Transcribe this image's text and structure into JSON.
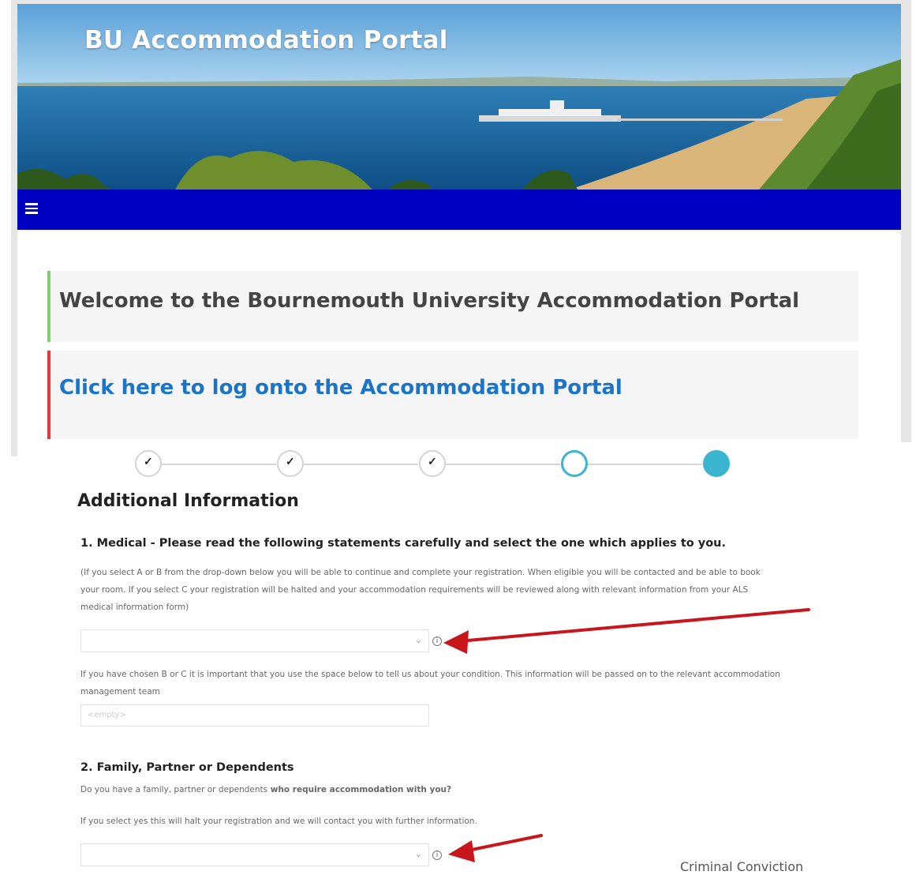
{
  "portal": {
    "site_title": "BU Accommodation Portal",
    "menu_icon": "hamburger-menu-icon",
    "welcome_heading": "Welcome to the Bournemouth University Accommodation Portal",
    "login_link": "Click here to log onto the Accommodation Portal",
    "colors": {
      "navbar": "#0000c2",
      "welcome_accent": "#7ccf6a",
      "login_accent": "#e2393f",
      "link": "#1a74c8"
    }
  },
  "form": {
    "stepper": {
      "steps": [
        {
          "state": "completed",
          "icon": "check-icon"
        },
        {
          "state": "completed",
          "icon": "check-icon"
        },
        {
          "state": "completed",
          "icon": "check-icon"
        },
        {
          "state": "current"
        },
        {
          "state": "upcoming"
        }
      ]
    },
    "section_title": "Additional Information",
    "medical": {
      "heading": "1. Medical - Please read the following statements carefully and select the one which applies to you.",
      "help_line1": "(If you select A or B from the drop-down below you will be able to continue and complete your registration. When eligible you will be contacted and be able to book",
      "help_line2": "your room. If you select C your registration will be halted and your accommodation requirements will be reviewed along with relevant information from your ALS",
      "help_line3": "medical information form)",
      "select_value": "",
      "condition_note_line1": "If you have chosen B or C it is important that you use the space below to tell us about your condition. This information will be passed on to the relevant accommodation",
      "condition_note_line2": "management team",
      "condition_placeholder": "<empty>"
    },
    "family": {
      "heading": "2. Family, Partner or Dependents",
      "question_prefix": "Do you have a family, partner or dependents",
      "question_bold": " who require accommodation with you?",
      "note": "If you select yes this will halt your registration and we will contact you with further information.",
      "select_value": ""
    },
    "next_section_label": "Criminal Conviction",
    "annotation_color": "#c8161d"
  }
}
